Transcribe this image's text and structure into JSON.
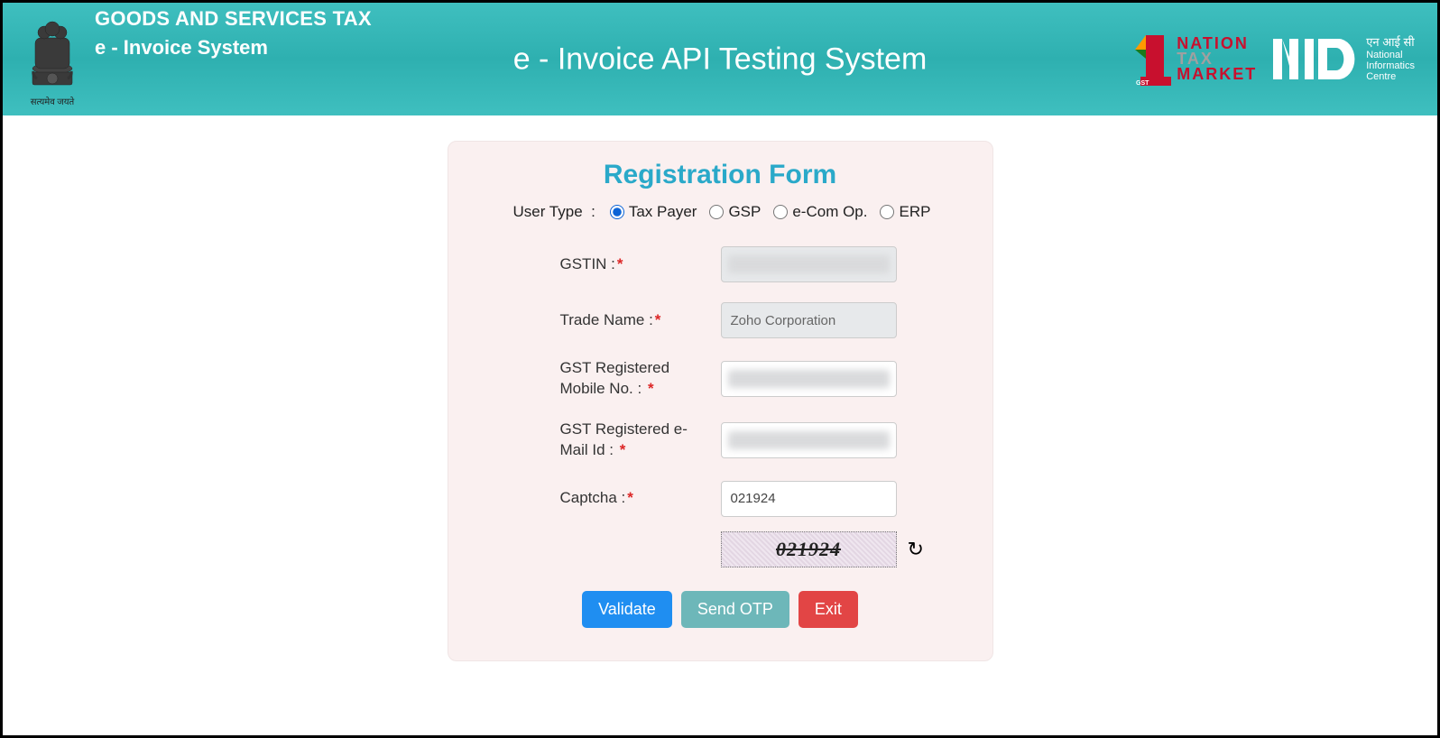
{
  "header": {
    "line1": "GOODS AND SERVICES TAX",
    "line2": "e - Invoice System",
    "center": "e - Invoice API Testing System",
    "emblem_caption": "सत्यमेव जयते",
    "ntm": {
      "nation": "NATION",
      "tax": "TAX",
      "market": "MARKET"
    },
    "nic": {
      "hindi": "एन आई सी",
      "en1": "National",
      "en2": "Informatics",
      "en3": "Centre"
    }
  },
  "form": {
    "title": "Registration Form",
    "user_type": {
      "label": "User Type",
      "options": [
        "Tax Payer",
        "GSP",
        "e-Com Op.",
        "ERP"
      ],
      "selected_index": 0
    },
    "fields": {
      "gstin": {
        "label": "GSTIN  :",
        "value": "",
        "required": true,
        "readonly": true
      },
      "trade_name": {
        "label": "Trade Name  :",
        "value": "Zoho Corporation",
        "required": true,
        "readonly": true
      },
      "mobile": {
        "label": "GST Registered Mobile No.  :",
        "value": "",
        "required": true,
        "readonly": false
      },
      "email": {
        "label": "GST Registered e-Mail Id :",
        "value": "",
        "required": true,
        "readonly": false
      },
      "captcha": {
        "label": "Captcha  :",
        "value": "021924",
        "required": true,
        "readonly": false
      }
    },
    "captcha_image_text": "021924",
    "buttons": {
      "validate": "Validate",
      "send_otp": "Send OTP",
      "exit": "Exit"
    }
  }
}
